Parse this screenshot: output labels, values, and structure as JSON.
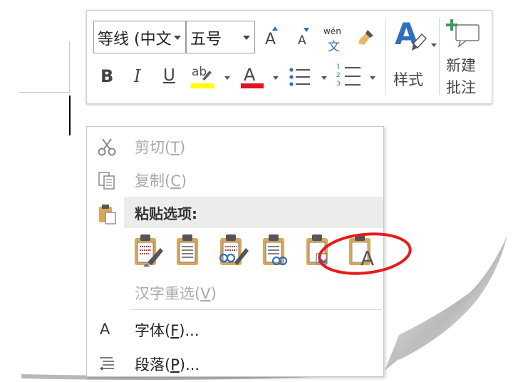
{
  "toolbar": {
    "font_name": "等线 (中文",
    "font_size": "五号",
    "grow_font_glyph": "A",
    "shrink_font_glyph": "A",
    "phonetic_top": "wén",
    "phonetic_bottom": "文",
    "bold": "B",
    "italic": "I",
    "underline": "U",
    "highlight_glyph": "ab",
    "font_color_glyph": "A",
    "numbering": [
      "1",
      "2",
      "3"
    ],
    "styles_glyph": "A",
    "styles_label": "样式",
    "new_comment_label_1": "新建",
    "new_comment_label_2": "批注",
    "colors": {
      "highlight": "#ffff00",
      "font_color": "#e81123",
      "accent_blue": "#2f6fbf"
    }
  },
  "menu": {
    "cut": {
      "text": "剪切(",
      "key": "T",
      "end": ")",
      "disabled": true
    },
    "copy": {
      "text": "复制(",
      "key": "C",
      "end": ")",
      "disabled": true
    },
    "paste_options_header": "粘贴选项:",
    "paste_options": [
      "keep-source-formatting-icon",
      "merge-formatting-icon",
      "use-destination-styles-icon",
      "link-and-keep-formatting-icon",
      "picture-icon",
      "keep-text-only-icon"
    ],
    "text_only_glyph": "A",
    "reconversion": {
      "text": "汉字重选(",
      "key": "V",
      "end": ")",
      "disabled": true
    },
    "font": {
      "text": "字体(",
      "key": "F",
      "end": ")...",
      "icon_glyph": "A"
    },
    "paragraph": {
      "text": "段落(",
      "key": "P",
      "end": ")..."
    }
  },
  "annotation": {
    "highlight_color": "#e51c1c"
  }
}
